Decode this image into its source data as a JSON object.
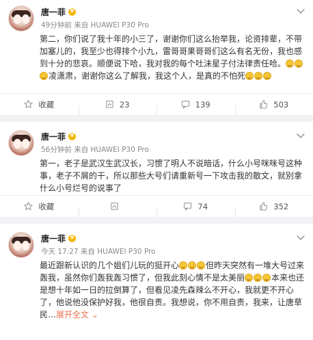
{
  "posts": [
    {
      "author": "唐一菲",
      "meta": "49分钟前 来自 HUAWEI P30 Pro",
      "text_before": "第二，你们说了我十年的小三了，谢谢你们这么抬举我，论资排辈，不带加塞儿的，我至少也得排个小九，雷哥哥果哥哥们这么有名无份，我也感到十分的悲哀。顺便说下哈，我对我的每个吐沫星子付法律责任哈。",
      "text_after": "凌潇肃，谢谢你这么了解我，我这个人，是真的不怕死",
      "actions": {
        "fav": "收藏",
        "repost": "23",
        "comment": "139",
        "like": "503"
      }
    },
    {
      "author": "唐一菲",
      "meta": "56分钟前 来自 HUAWEI P30 Pro",
      "text": "第一，老子是武汉生武汉长，习惯了明人不说暗话，什么小号咪咪号这种事，老子不屑的干，所以那些大号们请重新号一下攻击我的散文，就别拿什么小号烂号的说事了",
      "actions": {
        "fav": "收藏",
        "repost": "",
        "comment": "74",
        "like": "352"
      }
    },
    {
      "author": "唐一菲",
      "meta": "今天 17:27 来自 HUAWEI P30 Pro",
      "text_a": "最近跟新认识的几个姐们儿玩的挺开心",
      "text_b": "但昨天突然有一堆大号过来轰我，虽然你们轰我轰习惯了，但我此刻心情不是太美丽",
      "text_c": "本来也还是想十年如一日的拉倒算了，但看见凌先森辣么不开心，我就更不开心了，他说他没保护好我，他很自责。我想说，你不用自责，我来，让唐草民…",
      "expand": "展开全文",
      "expand_arrow": "⌄"
    }
  ]
}
